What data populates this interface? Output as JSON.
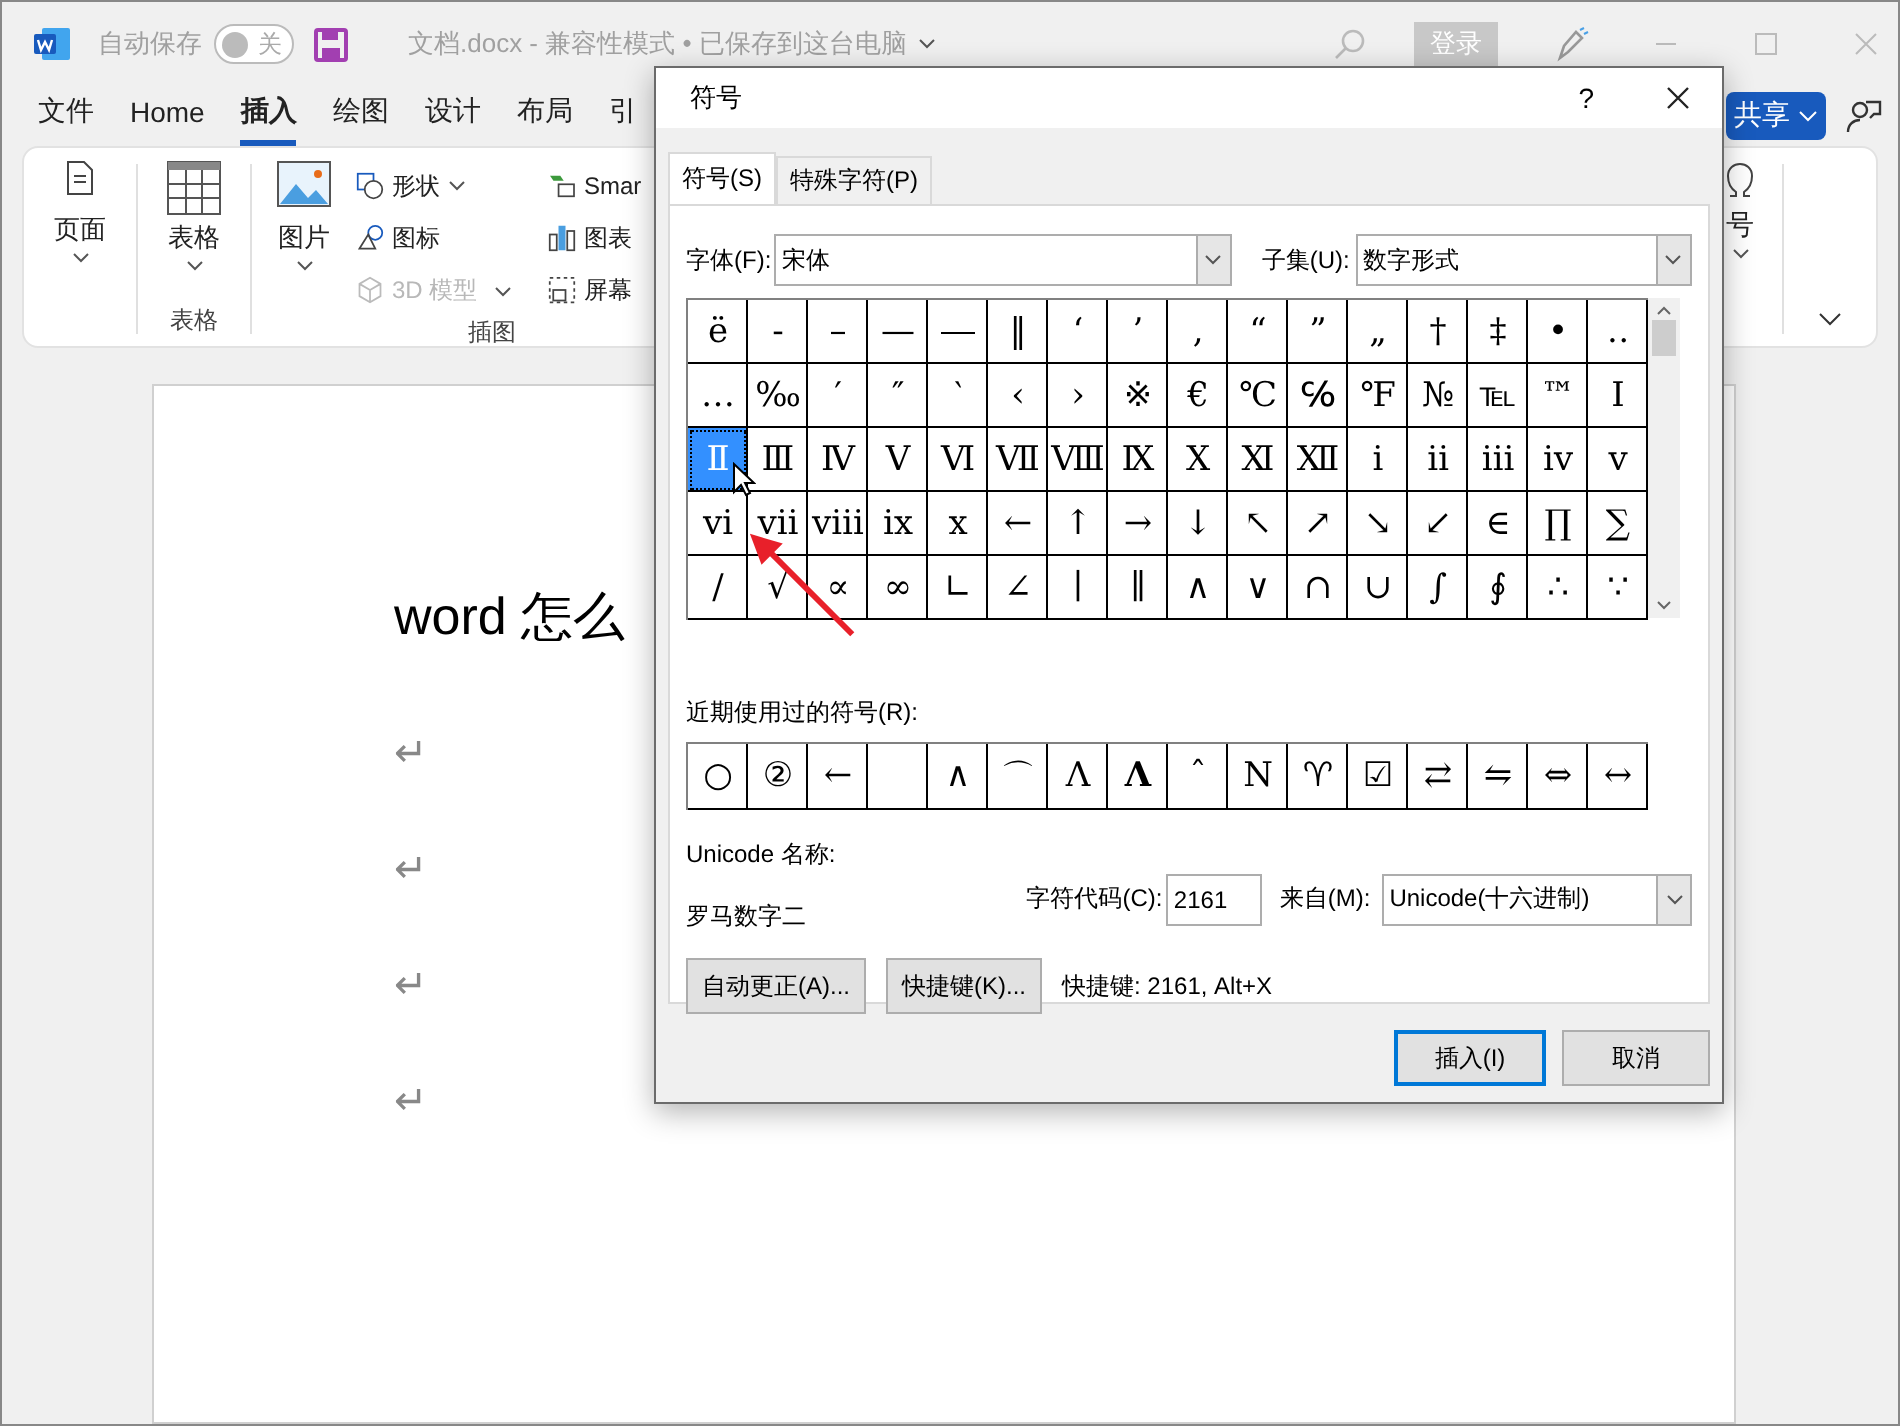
{
  "titlebar": {
    "autosave_label": "自动保存",
    "autosave_toggle": {
      "label": "关",
      "on": false
    },
    "document_title": "文档.docx  -  兼容性模式 • 已保存到这台电脑",
    "signin_button": "登录"
  },
  "menu": {
    "tabs": [
      {
        "label": "文件",
        "selected": false
      },
      {
        "label": "Home",
        "selected": false
      },
      {
        "label": "插入",
        "selected": true
      },
      {
        "label": "绘图",
        "selected": false
      },
      {
        "label": "设计",
        "selected": false
      },
      {
        "label": "布局",
        "selected": false
      },
      {
        "label": "引",
        "selected": false
      }
    ],
    "share_button": "共享"
  },
  "ribbon": {
    "page": "页面",
    "table": "表格",
    "table_group": "表格",
    "picture": "图片",
    "shapes": "形状",
    "icons": "图标",
    "model_3d": {
      "label": "3D 模型",
      "disabled": true
    },
    "smartart": "Smar",
    "chart": "图表",
    "screenshot": "屏幕",
    "illustrations_group": "插图",
    "symbol": "号"
  },
  "document": {
    "heading": "word 怎么",
    "paragraph_marks": [
      "↵",
      "↵",
      "↵",
      "↵"
    ]
  },
  "dialog": {
    "title": "符号",
    "help": "?",
    "tabs": [
      {
        "label": "符号(S)",
        "selected": true
      },
      {
        "label": "特殊字符(P)",
        "selected": false
      }
    ],
    "font_label": "字体(F):",
    "font_value": "宋体",
    "subset_label": "子集(U):",
    "subset_value": "数字形式",
    "symbols": [
      {
        "symbol": "ë",
        "selected": false
      },
      {
        "symbol": "‐",
        "selected": false
      },
      {
        "symbol": "–",
        "selected": false
      },
      {
        "symbol": "—",
        "selected": false
      },
      {
        "symbol": "―",
        "selected": false
      },
      {
        "symbol": "‖",
        "selected": false
      },
      {
        "symbol": "‘",
        "selected": false
      },
      {
        "symbol": "’",
        "selected": false
      },
      {
        "symbol": "‚",
        "selected": false
      },
      {
        "symbol": "“",
        "selected": false
      },
      {
        "symbol": "”",
        "selected": false
      },
      {
        "symbol": "„",
        "selected": false
      },
      {
        "symbol": "†",
        "selected": false
      },
      {
        "symbol": "‡",
        "selected": false
      },
      {
        "symbol": "•",
        "selected": false
      },
      {
        "symbol": "‥",
        "selected": false
      },
      {
        "symbol": "…",
        "selected": false
      },
      {
        "symbol": "‰",
        "selected": false
      },
      {
        "symbol": "′",
        "selected": false
      },
      {
        "symbol": "″",
        "selected": false
      },
      {
        "symbol": "‵",
        "selected": false
      },
      {
        "symbol": "‹",
        "selected": false
      },
      {
        "symbol": "›",
        "selected": false
      },
      {
        "symbol": "※",
        "selected": false
      },
      {
        "symbol": "€",
        "selected": false
      },
      {
        "symbol": "℃",
        "selected": false
      },
      {
        "symbol": "℅",
        "selected": false
      },
      {
        "symbol": "℉",
        "selected": false
      },
      {
        "symbol": "№",
        "selected": false
      },
      {
        "symbol": "℡",
        "selected": false
      },
      {
        "symbol": "™",
        "selected": false
      },
      {
        "symbol": "Ⅰ",
        "selected": false
      },
      {
        "symbol": "Ⅱ",
        "selected": true
      },
      {
        "symbol": "Ⅲ",
        "selected": false
      },
      {
        "symbol": "Ⅳ",
        "selected": false
      },
      {
        "symbol": "Ⅴ",
        "selected": false
      },
      {
        "symbol": "Ⅵ",
        "selected": false
      },
      {
        "symbol": "Ⅶ",
        "selected": false
      },
      {
        "symbol": "Ⅷ",
        "selected": false
      },
      {
        "symbol": "Ⅸ",
        "selected": false
      },
      {
        "symbol": "Ⅹ",
        "selected": false
      },
      {
        "symbol": "Ⅺ",
        "selected": false
      },
      {
        "symbol": "Ⅻ",
        "selected": false
      },
      {
        "symbol": "ⅰ",
        "selected": false
      },
      {
        "symbol": "ⅱ",
        "selected": false
      },
      {
        "symbol": "ⅲ",
        "selected": false
      },
      {
        "symbol": "ⅳ",
        "selected": false
      },
      {
        "symbol": "ⅴ",
        "selected": false
      },
      {
        "symbol": "ⅵ",
        "selected": false
      },
      {
        "symbol": "ⅶ",
        "selected": false
      },
      {
        "symbol": "ⅷ",
        "selected": false
      },
      {
        "symbol": "ⅸ",
        "selected": false
      },
      {
        "symbol": "ⅹ",
        "selected": false
      },
      {
        "symbol": "←",
        "selected": false
      },
      {
        "symbol": "↑",
        "selected": false
      },
      {
        "symbol": "→",
        "selected": false
      },
      {
        "symbol": "↓",
        "selected": false
      },
      {
        "symbol": "↖",
        "selected": false
      },
      {
        "symbol": "↗",
        "selected": false
      },
      {
        "symbol": "↘",
        "selected": false
      },
      {
        "symbol": "↙",
        "selected": false
      },
      {
        "symbol": "∈",
        "selected": false
      },
      {
        "symbol": "∏",
        "selected": false
      },
      {
        "symbol": "∑",
        "selected": false
      },
      {
        "symbol": "∕",
        "selected": false
      },
      {
        "symbol": "√",
        "selected": false
      },
      {
        "symbol": "∝",
        "selected": false
      },
      {
        "symbol": "∞",
        "selected": false
      },
      {
        "symbol": "∟",
        "selected": false
      },
      {
        "symbol": "∠",
        "selected": false
      },
      {
        "symbol": "∣",
        "selected": false
      },
      {
        "symbol": "∥",
        "selected": false
      },
      {
        "symbol": "∧",
        "selected": false
      },
      {
        "symbol": "∨",
        "selected": false
      },
      {
        "symbol": "∩",
        "selected": false
      },
      {
        "symbol": "∪",
        "selected": false
      },
      {
        "symbol": "∫",
        "selected": false
      },
      {
        "symbol": "∮",
        "selected": false
      },
      {
        "symbol": "∴",
        "selected": false
      },
      {
        "symbol": "∵",
        "selected": false
      }
    ],
    "recent_label": "近期使用过的符号(R):",
    "recent": [
      {
        "kind": "glyph",
        "symbol": "○"
      },
      {
        "kind": "glyph",
        "symbol": "②"
      },
      {
        "kind": "glyph",
        "symbol": "←"
      },
      {
        "kind": "blank"
      },
      {
        "kind": "glyph",
        "symbol": "∧"
      },
      {
        "kind": "glyph",
        "symbol": "⌒"
      },
      {
        "kind": "glyph",
        "symbol": "Λ"
      },
      {
        "kind": "bold",
        "symbol": "Λ"
      },
      {
        "kind": "glyph",
        "symbol": "ˆ"
      },
      {
        "kind": "glyph",
        "symbol": "N"
      },
      {
        "kind": "glyph",
        "symbol": "♈"
      },
      {
        "kind": "glyph",
        "symbol": "☑"
      },
      {
        "kind": "glyph",
        "symbol": "⇄"
      },
      {
        "kind": "glyph",
        "symbol": "⇋"
      },
      {
        "kind": "glyph",
        "symbol": "⇔"
      },
      {
        "kind": "glyph",
        "symbol": "↔"
      }
    ],
    "unicode_name_label": "Unicode 名称:",
    "unicode_name": "罗马数字二",
    "char_code_label": "字符代码(C):",
    "char_code": "2161",
    "from_label": "来自(M):",
    "from_value": "Unicode(十六进制)",
    "autocorrect_button": "自动更正(A)...",
    "shortcut_button": "快捷键(K)...",
    "shortcut_text": "快捷键: 2161, Alt+X",
    "insert_button": "插入(I)",
    "cancel_button": "取消"
  }
}
